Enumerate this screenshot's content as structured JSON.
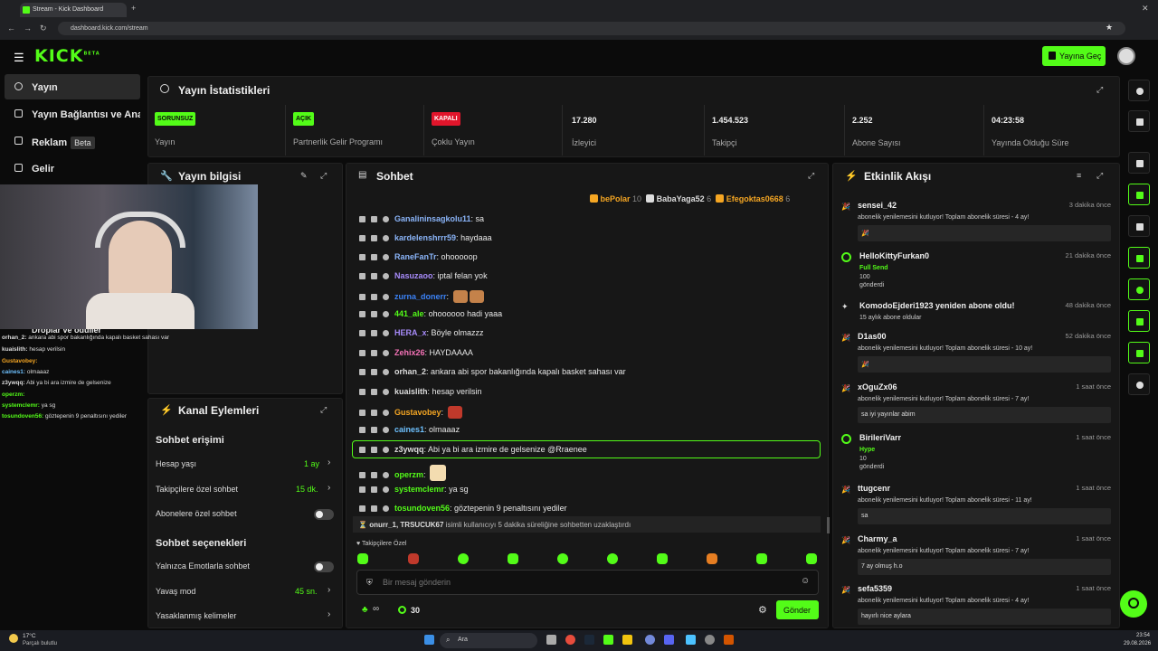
{
  "browser": {
    "tab_title": "Stream - Kick Dashboard",
    "url": "dashboard.kick.com/stream",
    "new_tab": "+"
  },
  "header": {
    "logo": "KICK",
    "logo_badge": "BETA",
    "go_live_label": "Yayına Geç"
  },
  "sidebar": {
    "items": [
      {
        "label": "Yayın",
        "icon": "broadcast-icon"
      },
      {
        "label": "Yayın Bağlantısı ve Anahtarı",
        "icon": "key-icon"
      },
      {
        "label": "Reklam",
        "icon": "ad-icon",
        "badge": "Beta"
      },
      {
        "label": "Gelir",
        "icon": "revenue-icon"
      },
      {
        "label": "Droplar ve ödüller",
        "icon": "gift-icon"
      }
    ]
  },
  "stats": {
    "title": "Yayın İstatistikleri",
    "cards": [
      {
        "pill": "SORUNSUZ",
        "pill_color": "#53fc18",
        "label": "Yayın"
      },
      {
        "pill": "AÇIK",
        "pill_color": "#53fc18",
        "label": "Partnerlik Gelir Programı"
      },
      {
        "pill": "KAPALI",
        "pill_color": "#e0152b",
        "label": "Çoklu Yayın"
      },
      {
        "value": "17.280",
        "label": "İzleyici"
      },
      {
        "value": "1.454.523",
        "label": "Takipçi"
      },
      {
        "value": "2.252",
        "label": "Abone Sayısı"
      },
      {
        "value": "04:23:58",
        "label": "Yayında Olduğu Süre"
      }
    ]
  },
  "stream_info": {
    "title": "Yayın bilgisi"
  },
  "webcam_overlay_chat": [
    {
      "user": "orhan_2:",
      "text": "ankara abi spor bakanlığında kapalı basket sahası var",
      "color": "#dddddd"
    },
    {
      "user": "kuaislith:",
      "text": "hesap verilsin",
      "color": "#dddddd"
    },
    {
      "user": "Gustavobey:",
      "text": "",
      "color": "#f5a623"
    },
    {
      "user": "caines1:",
      "text": "olmaaaz",
      "color": "#6ec1ff"
    },
    {
      "user": "z3ywqq:",
      "text": "Abi ya bi ara izmire de gelsenize",
      "color": "#dddddd"
    },
    {
      "user": "operzm:",
      "text": "",
      "color": "#53fc18"
    },
    {
      "user": "systemclemr:",
      "text": "ya sg",
      "color": "#53fc18"
    },
    {
      "user": "tosundoven56:",
      "text": "göztepenin 9 penaltısını yediler",
      "color": "#53fc18"
    }
  ],
  "channel_actions": {
    "title": "Kanal Eylemleri",
    "section1": "Sohbet erişimi",
    "rows1": [
      {
        "label": "Hesap yaşı",
        "value": "1 ay"
      },
      {
        "label": "Takipçilere özel sohbet",
        "value": "15 dk."
      },
      {
        "label": "Abonelere özel sohbet",
        "value": ""
      }
    ],
    "section2": "Sohbet seçenekleri",
    "rows2": [
      {
        "label": "Yalnızca Emotlarla sohbet",
        "value": ""
      },
      {
        "label": "Yavaş mod",
        "value": "45 sn."
      },
      {
        "label": "Yasaklanmış kelimeler",
        "value": ""
      }
    ]
  },
  "chat": {
    "title": "Sohbet",
    "top_gifters": [
      {
        "name": "bePolar",
        "count": "10",
        "color": "#f5a623"
      },
      {
        "name": "BabaYaga52",
        "count": "6",
        "color": "#dddddd"
      },
      {
        "name": "Efegoktas0668",
        "count": "6",
        "color": "#f5a623"
      }
    ],
    "messages": [
      {
        "user": "Ganalininsagkolu11",
        "text": "sa",
        "color": "#8ab4f8"
      },
      {
        "user": "kardelenshrrr59",
        "text": "haydaaa",
        "color": "#8ab4f8"
      },
      {
        "user": "RaneFanTr",
        "text": "ohooooop",
        "color": "#8ab4f8"
      },
      {
        "user": "Nasuzaoo",
        "text": "iptal felan yok",
        "color": "#a78bfa"
      },
      {
        "user": "zurna_donerr",
        "text": "",
        "color": "#3b82f6"
      },
      {
        "user": "441_ale",
        "text": "ohoooooo hadi yaaa",
        "color": "#53fc18"
      },
      {
        "user": "HERA_x",
        "text": "Böyle olmazzz",
        "color": "#a78bfa"
      },
      {
        "user": "Zehix26",
        "text": "HAYDAAAA",
        "color": "#f472b6"
      },
      {
        "user": "orhan_2",
        "text": "ankara abi spor bakanlığında kapalı basket sahası var",
        "color": "#dddddd"
      },
      {
        "user": "kuaislith",
        "text": "hesap verilsin",
        "color": "#dddddd"
      },
      {
        "user": "Gustavobey",
        "text": "",
        "color": "#f5a623"
      },
      {
        "user": "caines1",
        "text": "olmaaaz",
        "color": "#6ec1ff"
      },
      {
        "user": "z3ywqq",
        "text": "Abi ya bi ara izmire de gelsenize",
        "mention": "@Rraenee",
        "color": "#dddddd"
      },
      {
        "user": "operzm",
        "text": "",
        "color": "#53fc18"
      },
      {
        "user": "systemclemr",
        "text": "ya sg",
        "color": "#53fc18"
      },
      {
        "user": "tosundoven56",
        "text": "göztepenin 9 penaltısını yediler",
        "color": "#53fc18"
      }
    ],
    "system_notice": "isimli kullanıcıyı 5 dakika süreliğine sohbetten uzaklaştırdı",
    "system_users": "onurr_1, TRSUCUK67",
    "followers_only_label": "Takipçilere Özel",
    "input_placeholder": "Bir mesaj gönderin",
    "infinity_label": "∞",
    "points": "30",
    "send_label": "Gönder"
  },
  "activity": {
    "title": "Etkinlik Akışı",
    "events": [
      {
        "user": "sensei_42",
        "time": "3 dakika önce",
        "desc": "abonelik yenilemesini kutluyor! Toplam abonelik süresi - 4 ay!",
        "box": "🎉"
      },
      {
        "user": "HelloKittyFurkan0",
        "time": "21 dakika önce",
        "desc": "Full Send",
        "desc2": "100",
        "desc3": "gönderdi"
      },
      {
        "user": "KomodoEjderi1923 yeniden abone oldu!",
        "time": "48 dakika önce",
        "desc": "15 aylık abone oldular"
      },
      {
        "user": "D1as00",
        "time": "52 dakika önce",
        "desc": "abonelik yenilemesini kutluyor! Toplam abonelik süresi - 10 ay!",
        "box": "🎉"
      },
      {
        "user": "xOguZx06",
        "time": "1 saat önce",
        "desc": "abonelik yenilemesini kutluyor! Toplam abonelik süresi - 7 ay!",
        "box": "sa iyi yayınlar abim"
      },
      {
        "user": "BirileriVarr",
        "time": "1 saat önce",
        "desc": "Hype",
        "desc2": "10",
        "desc3": "gönderdi"
      },
      {
        "user": "ttugcenr",
        "time": "1 saat önce",
        "desc": "abonelik yenilemesini kutluyor! Toplam abonelik süresi - 11 ay!",
        "box": "sa"
      },
      {
        "user": "Charmy_a",
        "time": "1 saat önce",
        "desc": "abonelik yenilemesini kutluyor! Toplam abonelik süresi - 7 ay!",
        "box": "7 ay olmuş h.o"
      },
      {
        "user": "sefa5359",
        "time": "1 saat önce",
        "desc": "abonelik yenilemesini kutluyor! Toplam abonelik süresi - 4 ay!",
        "box": "hayırlı nice aylara"
      }
    ]
  },
  "taskbar": {
    "weather_temp": "17°C",
    "weather_desc": "Parçalı bulutlu",
    "search": "Ara",
    "time": "23:54",
    "date": "29.08.2026"
  },
  "colors": {
    "accent": "#53fc18",
    "danger": "#e0152b",
    "panel": "#171717"
  }
}
